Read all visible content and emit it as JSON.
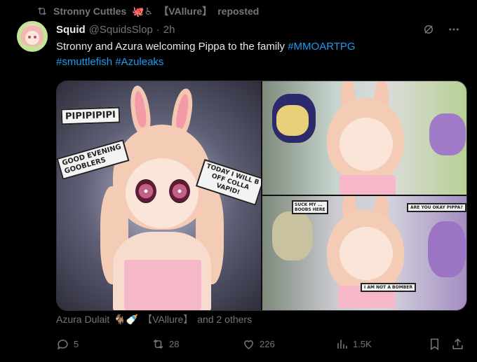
{
  "repost": {
    "user": "Stronny Cuttles",
    "emojis": "🐙♿",
    "tag": "【VAllure】",
    "action": "reposted"
  },
  "tweet": {
    "name": "Squid",
    "handle": "@SquidsSlop",
    "dot": "·",
    "time": "2h",
    "text": "Stronny and Azura welcoming Pippa to the family",
    "hashtags": [
      "#MMOARTPG",
      "#smuttlefish",
      "#Azuleaks"
    ]
  },
  "media": {
    "stickers": {
      "pipi": "PIPIPIPIPI",
      "evening1": "GOOD EVENING",
      "evening2": "GOOBLERS",
      "today1": "TODAY I WILL B",
      "today2": "OFF COLLA",
      "today3": "VAPID!",
      "okay": "ARE YOU OKAY PIPPA?",
      "abuse": "I AM NOT A BOMBER",
      "small": "SUCK MY ...",
      "small2": "BOOBS HERE"
    }
  },
  "tagged": {
    "user": "Azura Dulait",
    "emojis": "🐐🍼",
    "tag": "【VAllure】",
    "others": "and 2 others"
  },
  "stats": {
    "replies": "5",
    "reposts": "28",
    "likes": "226",
    "views": "1.5K"
  },
  "colors": {
    "background": "#000000",
    "text": "#e7e9ea",
    "muted": "#71767b",
    "accent": "#1d9bf0"
  }
}
